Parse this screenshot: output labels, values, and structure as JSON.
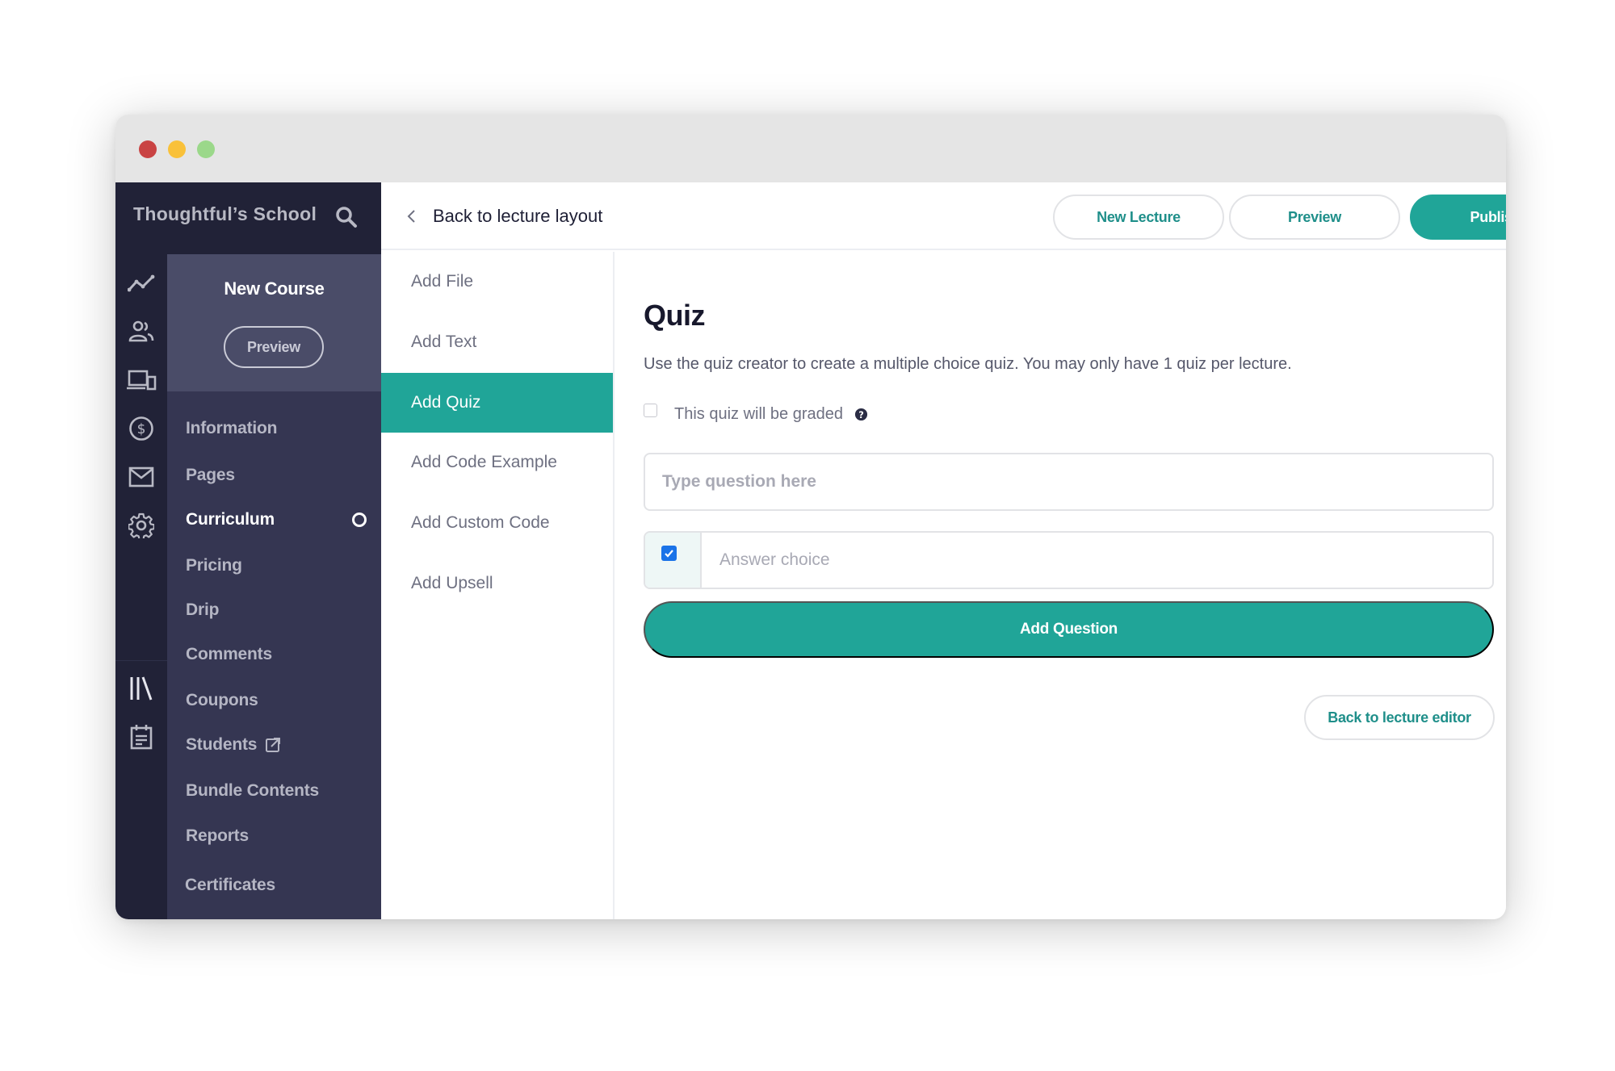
{
  "window": {
    "controls": [
      "close",
      "minimize",
      "maximize"
    ]
  },
  "school": {
    "name": "Thoughtful’s School",
    "search_icon": "search-icon"
  },
  "iconbar": {
    "items": [
      {
        "name": "stats",
        "icon": "line-chart-icon"
      },
      {
        "name": "users",
        "icon": "users-icon"
      },
      {
        "name": "site",
        "icon": "devices-icon"
      },
      {
        "name": "sales",
        "icon": "dollar-icon"
      },
      {
        "name": "emails",
        "icon": "mail-icon"
      },
      {
        "name": "settings",
        "icon": "gear-icon"
      },
      {
        "name": "library",
        "icon": "library-icon"
      },
      {
        "name": "calendar",
        "icon": "calendar-icon"
      }
    ]
  },
  "course": {
    "title": "New Course",
    "preview_label": "Preview",
    "nav": [
      {
        "label": "Information",
        "active": false
      },
      {
        "label": "Pages",
        "active": false
      },
      {
        "label": "Curriculum",
        "active": true
      },
      {
        "label": "Pricing",
        "active": false
      },
      {
        "label": "Drip",
        "active": false
      },
      {
        "label": "Comments",
        "active": false
      },
      {
        "label": "Coupons",
        "active": false
      },
      {
        "label": "Students",
        "active": false,
        "external": true
      },
      {
        "label": "Bundle Contents",
        "active": false
      },
      {
        "label": "Reports",
        "active": false
      },
      {
        "label": "Certificates",
        "active": false
      }
    ]
  },
  "topbar": {
    "back_label": "Back to lecture layout",
    "new_lecture_label": "New Lecture",
    "preview_label": "Preview",
    "publish_label": "Publish"
  },
  "lesson_nav": {
    "items": [
      {
        "label": "Add File",
        "active": false
      },
      {
        "label": "Add Text",
        "active": false
      },
      {
        "label": "Add Quiz",
        "active": true
      },
      {
        "label": "Add Code Example",
        "active": false
      },
      {
        "label": "Add Custom Code",
        "active": false
      },
      {
        "label": "Add Upsell",
        "active": false
      }
    ]
  },
  "quiz": {
    "title": "Quiz",
    "description": "Use the quiz creator to create a multiple choice quiz. You may only have 1 quiz per lecture.",
    "graded_label": "This quiz will be graded",
    "graded_checked": false,
    "question_placeholder": "Type question here",
    "question_value": "",
    "answer_placeholder": "Answer choice",
    "answer_value": "",
    "answer_correct_checked": true,
    "add_question_label": "Add Question",
    "back_editor_label": "Back to lecture editor"
  },
  "colors": {
    "accent": "#20a598",
    "sidebar_dark": "#212237",
    "sidebar": "#353652",
    "sidebar_header": "#4a4c68"
  }
}
